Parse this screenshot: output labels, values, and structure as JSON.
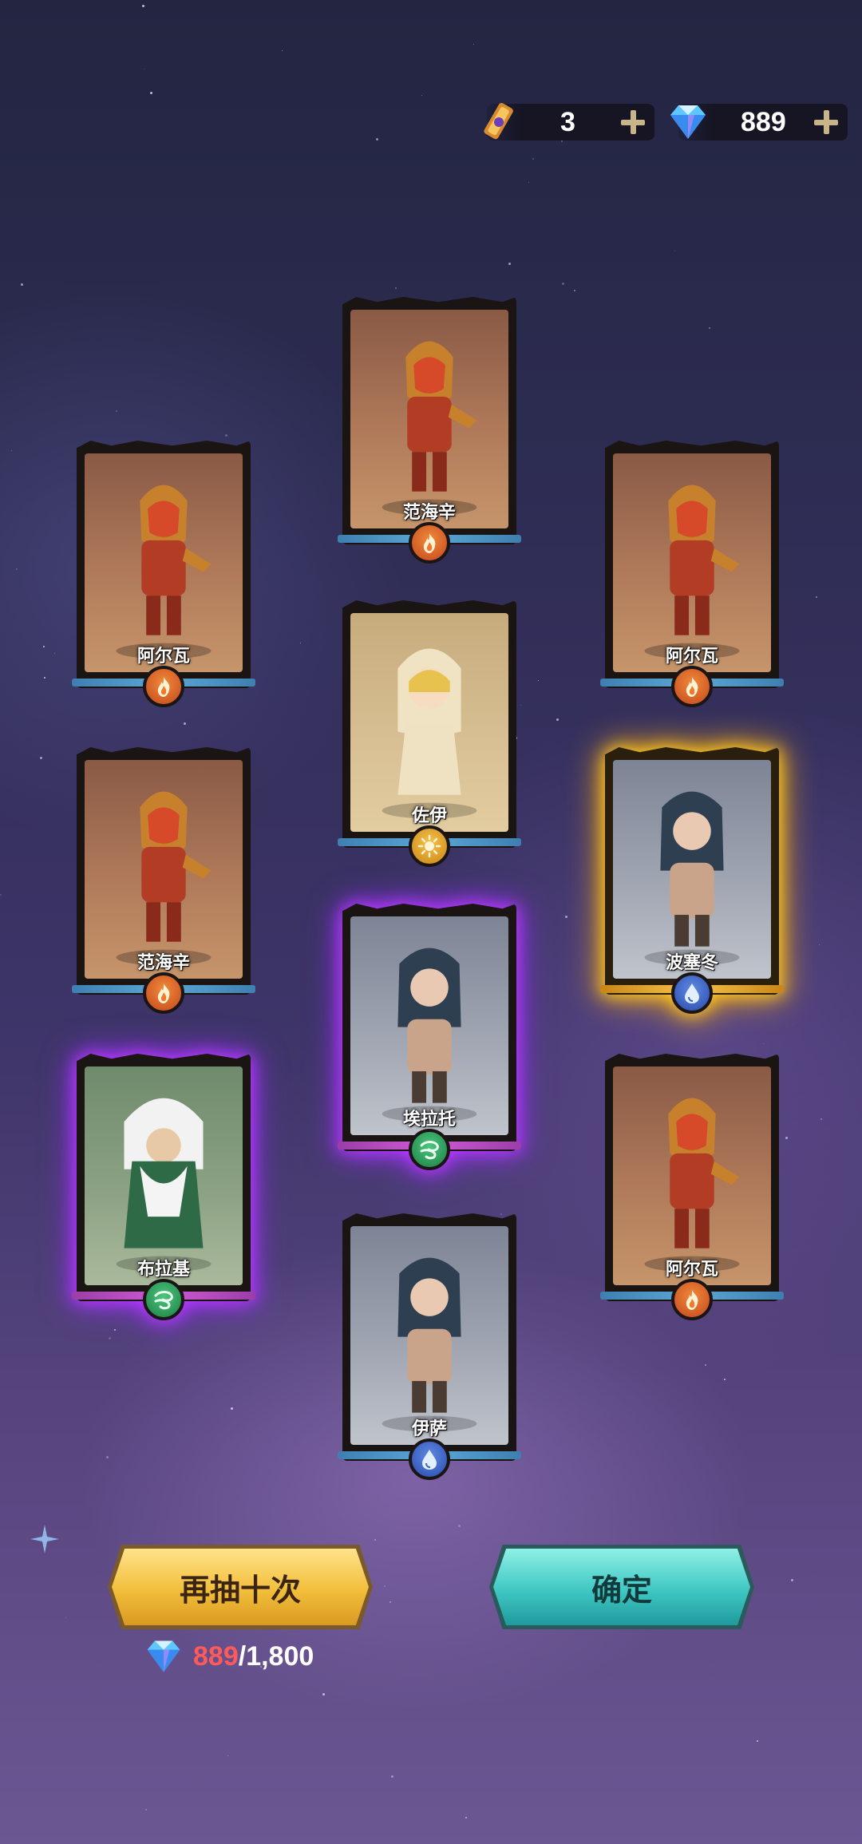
{
  "currency": {
    "tickets": {
      "icon": "summon-ticket-icon",
      "value": "3"
    },
    "diamonds": {
      "icon": "diamond-icon",
      "value": "889"
    }
  },
  "cards": [
    {
      "name": "范海辛",
      "element": "fire",
      "rarity": "normal",
      "art": "warm"
    },
    {
      "name": "阿尔瓦",
      "element": "fire",
      "rarity": "normal",
      "art": "warm"
    },
    {
      "name": "阿尔瓦",
      "element": "fire",
      "rarity": "normal",
      "art": "warm"
    },
    {
      "name": "佐伊",
      "element": "light",
      "rarity": "normal",
      "art": "sand"
    },
    {
      "name": "范海辛",
      "element": "fire",
      "rarity": "normal",
      "art": "warm"
    },
    {
      "name": "波塞冬",
      "element": "water",
      "rarity": "gold",
      "art": "grey"
    },
    {
      "name": "埃拉托",
      "element": "wind",
      "rarity": "purple",
      "art": "grey"
    },
    {
      "name": "布拉基",
      "element": "wind",
      "rarity": "purple",
      "art": "green"
    },
    {
      "name": "阿尔瓦",
      "element": "fire",
      "rarity": "normal",
      "art": "warm"
    },
    {
      "name": "伊萨",
      "element": "water",
      "rarity": "normal",
      "art": "grey"
    }
  ],
  "buttons": {
    "redraw": "再抽十次",
    "confirm": "确定"
  },
  "cost": {
    "icon": "diamond-icon",
    "have": "889",
    "separator": "/",
    "need": "1,800"
  },
  "colors": {
    "fire": "#e0632a",
    "water": "#3b63c7",
    "wind": "#2e9d58",
    "light": "#e3a12a",
    "purple_glow": "#b43cff",
    "gold_glow": "#ffc21a"
  }
}
